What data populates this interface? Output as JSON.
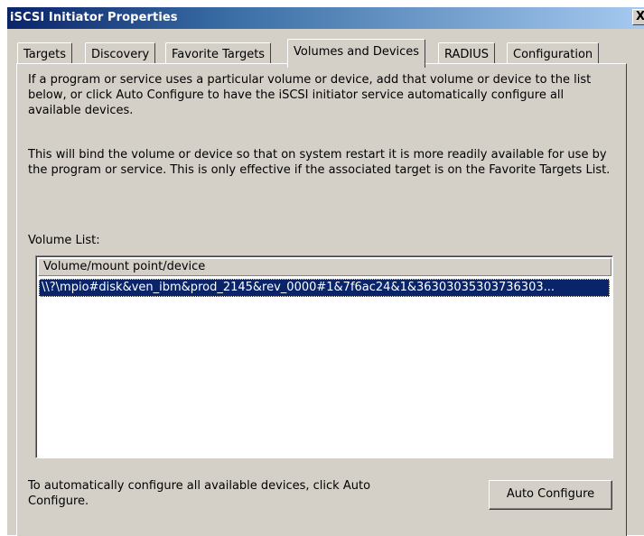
{
  "window": {
    "title": "iSCSI Initiator Properties",
    "close_glyph": "X"
  },
  "tabs": [
    {
      "label": "Targets",
      "active": false
    },
    {
      "label": "Discovery",
      "active": false
    },
    {
      "label": "Favorite Targets",
      "active": false
    },
    {
      "label": "Volumes and Devices",
      "active": true
    },
    {
      "label": "RADIUS",
      "active": false
    },
    {
      "label": "Configuration",
      "active": false
    }
  ],
  "panel": {
    "intro_text": "If a program or service uses a particular volume or device, add that volume or device to the list below, or click Auto Configure to have the iSCSI initiator service automatically configure all available devices.",
    "bind_text": "This will bind the volume or device so that on system restart it is more readily available for use by the program or service.  This is only effective if the associated target is on the Favorite Targets List.",
    "volume_list_label": "Volume List:",
    "column_header": "Volume/mount point/device",
    "volumes": [
      "\\\\?\\mpio#disk&ven_ibm&prod_2145&rev_0000#1&7f6ac24&1&36303035303736303..."
    ],
    "auto_configure_text": "To automatically configure all available devices, click Auto Configure.",
    "auto_configure_button": "Auto Configure"
  },
  "colors": {
    "face": "#d4d0c8",
    "selection": "#0a246a",
    "title_gradient_start": "#0a246a",
    "title_gradient_end": "#a6caf0"
  }
}
